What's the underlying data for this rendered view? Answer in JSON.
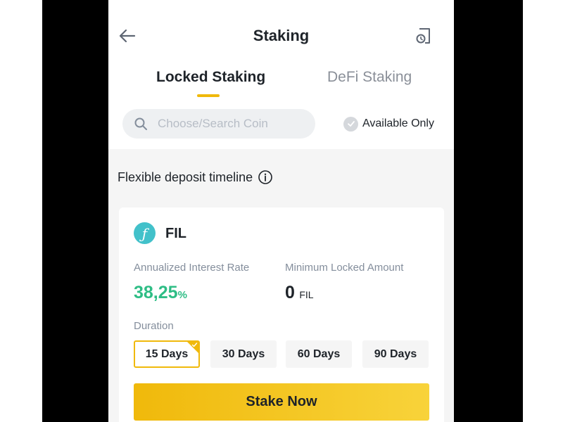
{
  "header": {
    "title": "Staking",
    "back_icon": "arrow-left-icon",
    "history_icon": "history-icon"
  },
  "tabs": [
    {
      "label": "Locked Staking",
      "active": true
    },
    {
      "label": "DeFi Staking",
      "active": false
    }
  ],
  "search": {
    "placeholder": "Choose/Search Coin",
    "value": ""
  },
  "filter": {
    "available_only_label": "Available Only",
    "checked": false
  },
  "section": {
    "timeline_label": "Flexible deposit timeline"
  },
  "product": {
    "coin": "FIL",
    "coin_symbol": "ƒ",
    "rate_label": "Annualized Interest Rate",
    "rate_value": "38,25",
    "rate_unit": "%",
    "min_label": "Minimum Locked Amount",
    "min_value": "0",
    "min_unit": "FIL",
    "duration_label": "Duration",
    "durations": [
      {
        "label": "15 Days",
        "selected": true
      },
      {
        "label": "30 Days",
        "selected": false
      },
      {
        "label": "60 Days",
        "selected": false
      },
      {
        "label": "90 Days",
        "selected": false
      }
    ],
    "stake_label": "Stake Now"
  },
  "colors": {
    "accent": "#f0b90b",
    "positive": "#2ebd85",
    "coin_logo": "#42c1ca",
    "text": "#1e2329",
    "muted": "#848e9c"
  }
}
